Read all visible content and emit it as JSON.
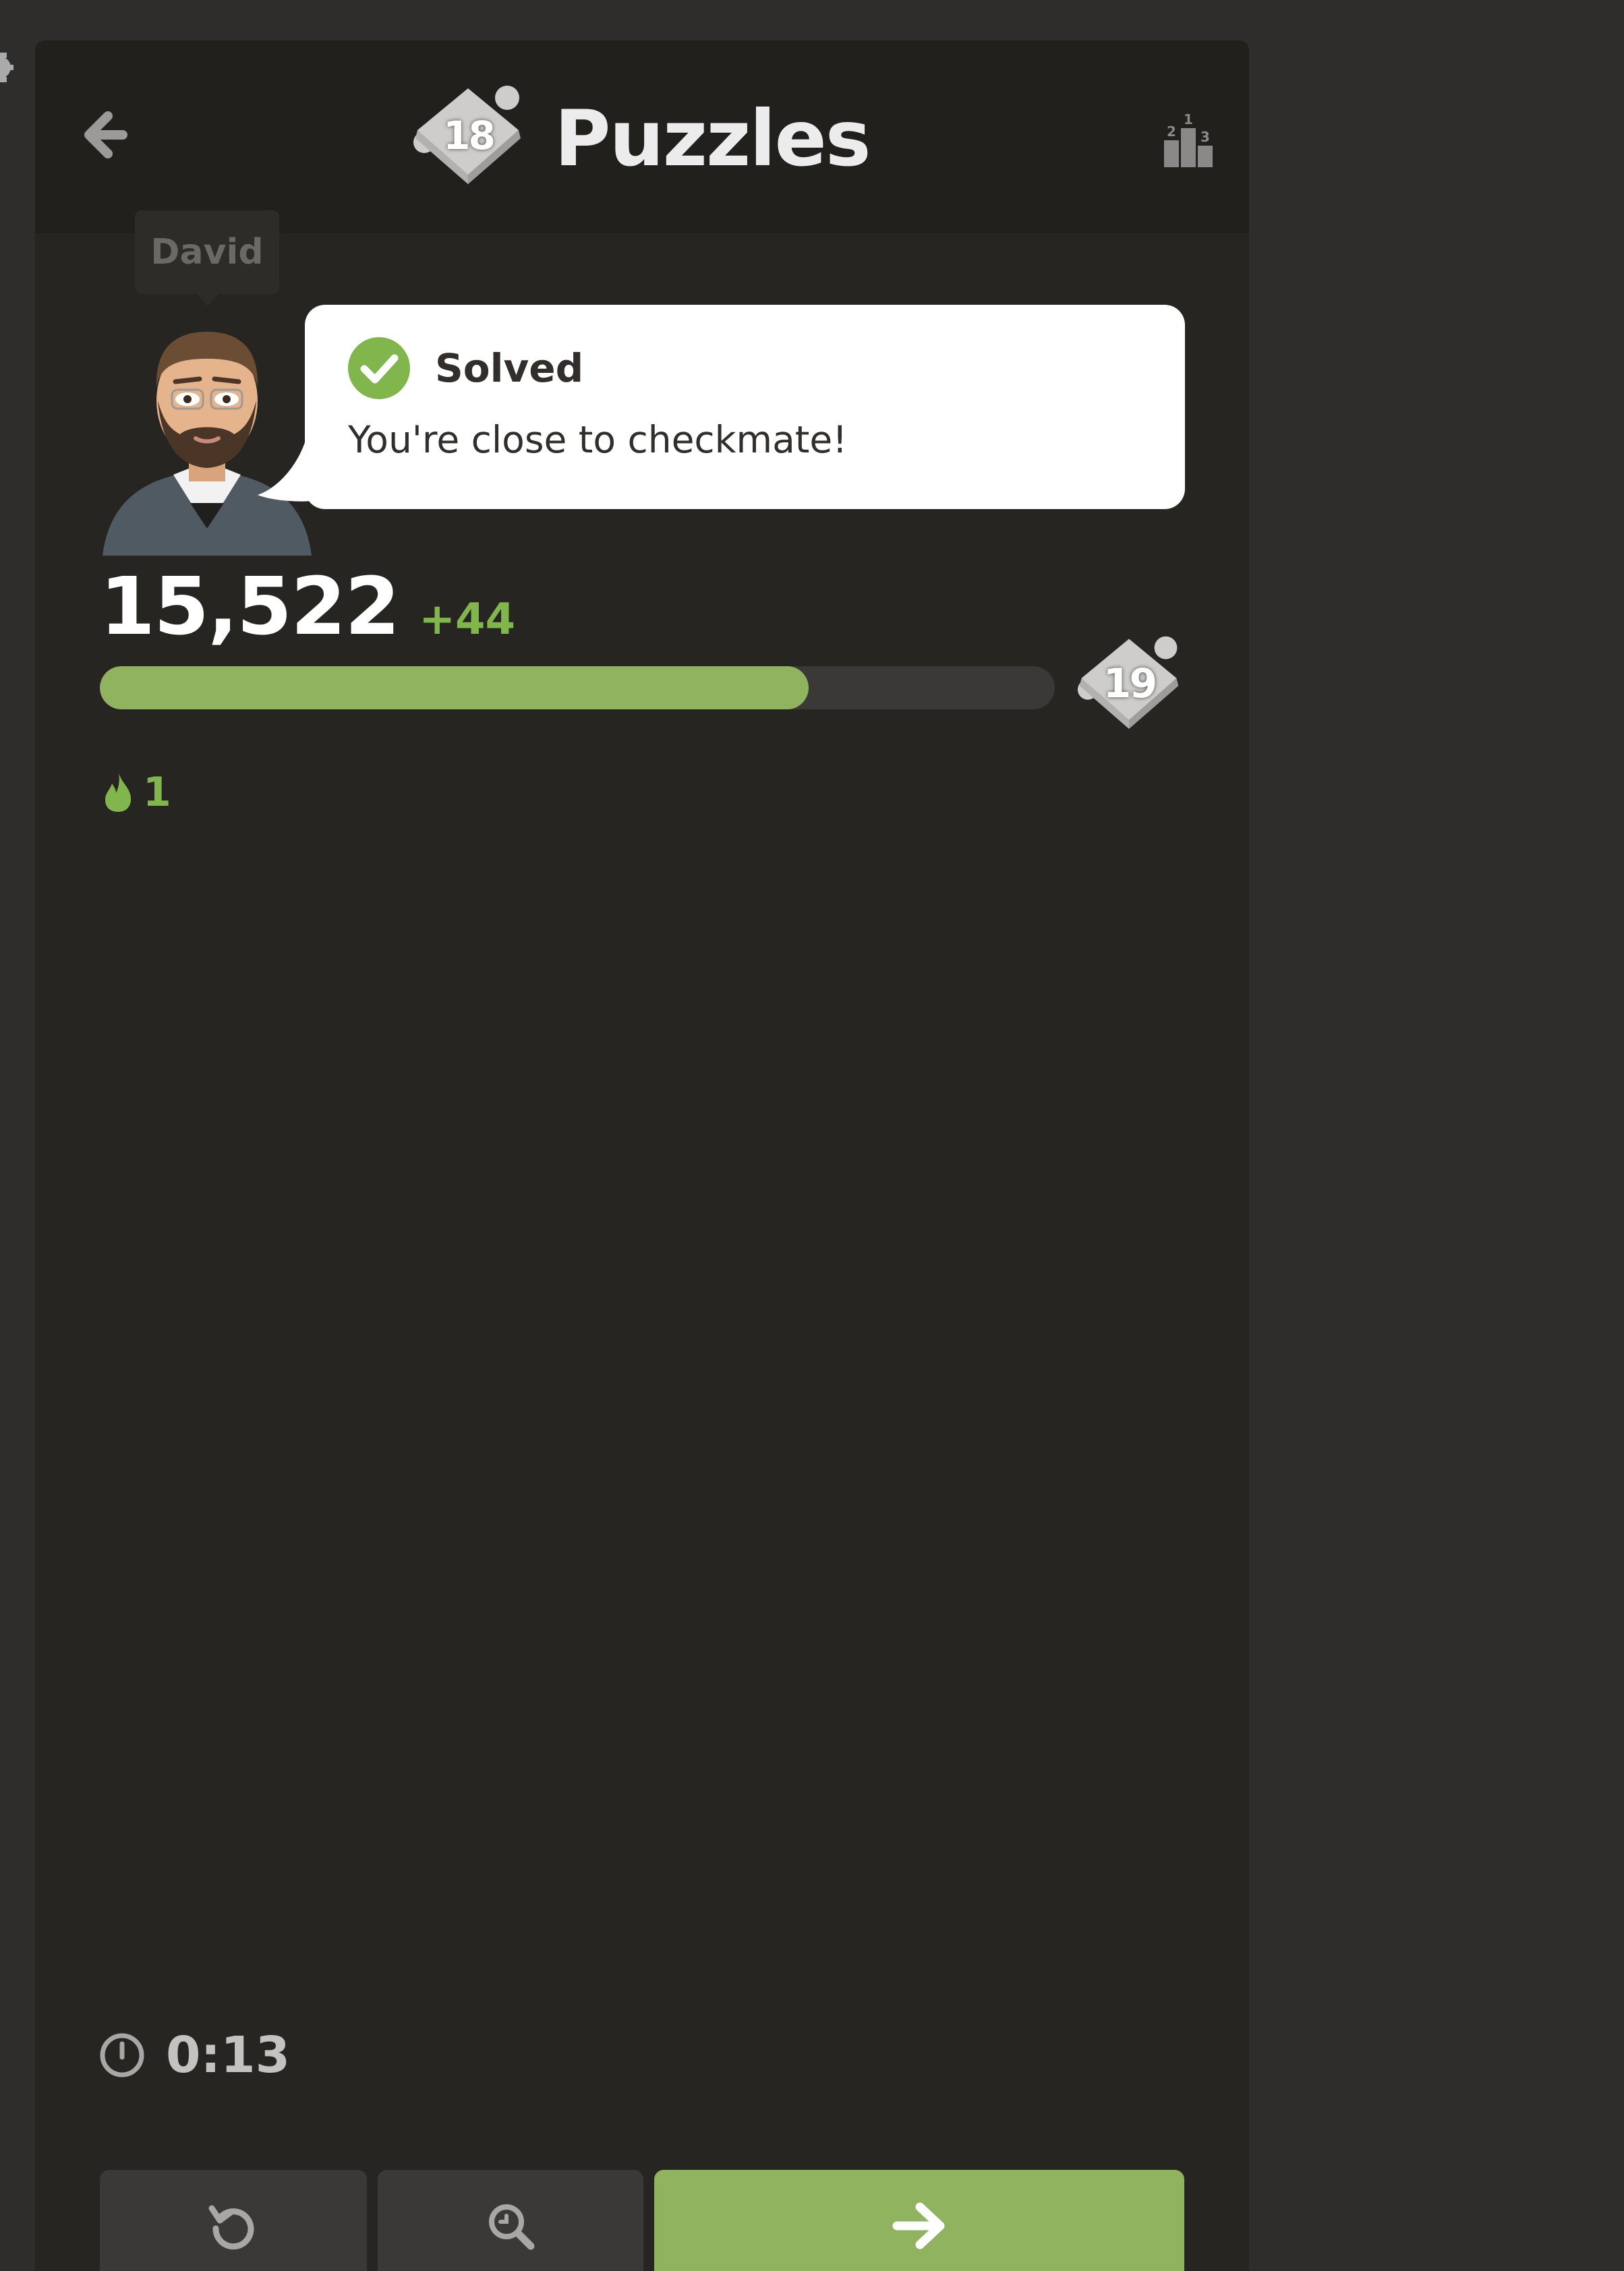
{
  "header": {
    "back_icon": "arrow-left-icon",
    "level": "18",
    "title": "Puzzles",
    "leaderboard_icon": "podium-icon"
  },
  "coach": {
    "name": "David",
    "avatar": "coach-avatar"
  },
  "feedback": {
    "status": "Solved",
    "status_icon": "check-circle-icon",
    "message": "You're close to checkmate!"
  },
  "rating": {
    "value": "15,522",
    "delta": "+44",
    "progress_fraction": 0.742,
    "next_level": "19"
  },
  "streak": {
    "icon": "flame-icon",
    "count": "1"
  },
  "timer": {
    "icon": "clock-icon",
    "value": "0:13"
  },
  "actions": [
    {
      "icon": "retry-icon"
    },
    {
      "icon": "analyze-magnifier-icon"
    },
    {
      "icon": "arrow-right-icon"
    }
  ],
  "colors": {
    "accent_green": "#81b64c",
    "button_green": "#8fb35e",
    "panel_bg": "#262522",
    "header_bg": "#21201d"
  }
}
